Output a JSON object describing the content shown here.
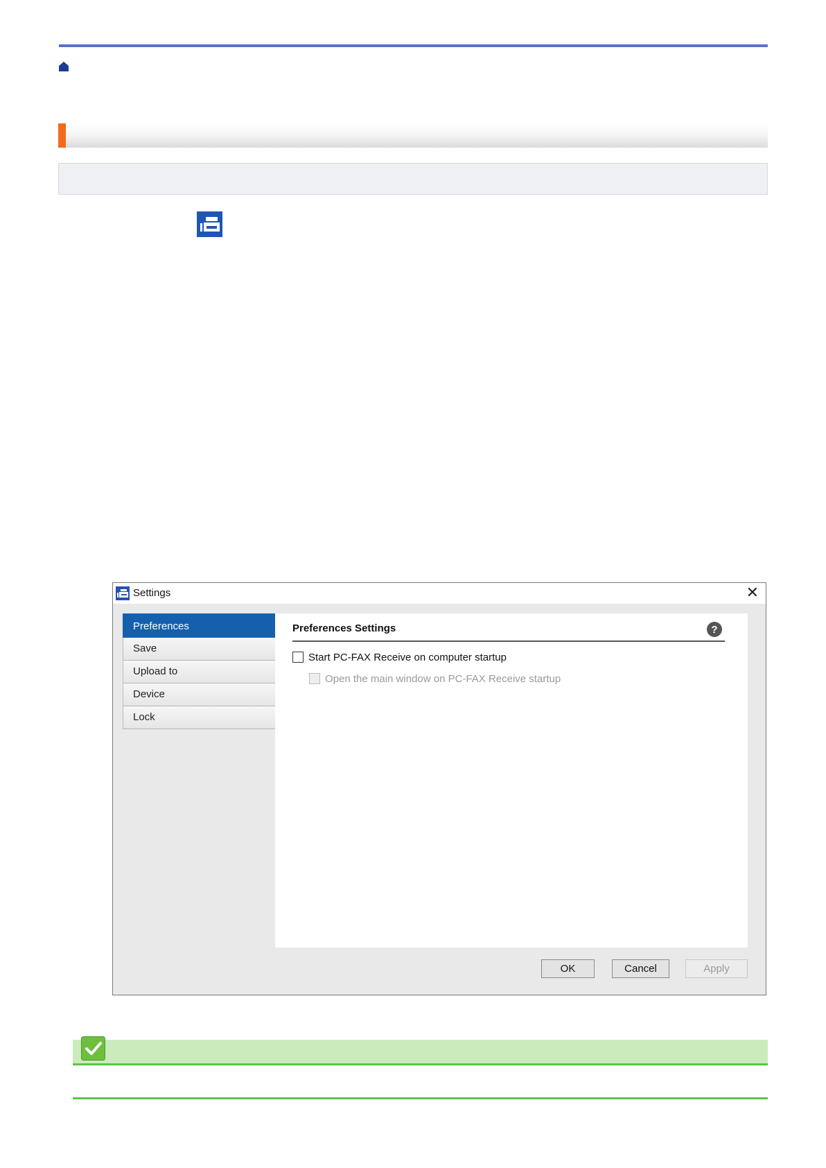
{
  "icons": {
    "home": "home-icon",
    "app": "pc-fax-receive-icon",
    "help": "help-icon",
    "close": "close-icon",
    "note": "checkmark-icon"
  },
  "colors": {
    "top_rule": "#5b6fd0",
    "section_accent": "#f26a1b",
    "nav_active": "#1560ad",
    "note_bar": "#ccebbd",
    "note_rule": "#5fc14a"
  },
  "dialog": {
    "title": "Settings",
    "close_glyph": "✕",
    "nav_items": [
      {
        "label": "Preferences",
        "active": true
      },
      {
        "label": "Save",
        "active": false
      },
      {
        "label": "Upload to",
        "active": false
      },
      {
        "label": "Device",
        "active": false
      },
      {
        "label": "Lock",
        "active": false
      }
    ],
    "panel": {
      "title": "Preferences Settings",
      "option_startup": {
        "label": "Start PC-FAX Receive on computer startup",
        "checked": false,
        "enabled": true
      },
      "option_open_main": {
        "label": "Open the main window on PC-FAX Receive startup",
        "checked": false,
        "enabled": false
      }
    },
    "buttons": {
      "ok": "OK",
      "cancel": "Cancel",
      "apply": "Apply"
    }
  }
}
